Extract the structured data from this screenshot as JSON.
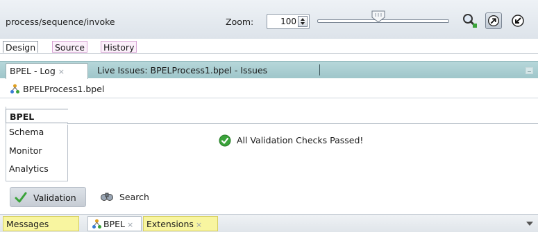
{
  "editor": {
    "path": "process/sequence/invoke",
    "zoom_label": "Zoom:",
    "zoom_value": "100",
    "zoom_slider_level_percent": 46,
    "icons": [
      "zoom-to-fit-icon",
      "pan-icon",
      "collapse-icon"
    ]
  },
  "view_tabs": {
    "design": "Design",
    "source": "Source",
    "history": "History"
  },
  "log_panel": {
    "active_tab": "BPEL - Log",
    "close_glyph": "×",
    "inactive_tab": "Live Issues: BPELProcess1.bpel - Issues"
  },
  "file": {
    "name": "BPELProcess1.bpel",
    "icon": "bpel-process-icon"
  },
  "categories": [
    "BPEL",
    "Schema",
    "Monitor",
    "Analytics"
  ],
  "status_message": "All Validation Checks Passed!",
  "toolbar": {
    "validation": "Validation",
    "search": "Search"
  },
  "bottom_tabs": {
    "messages": "Messages",
    "bpel": "BPEL",
    "extensions": "Extensions",
    "close_glyph": "×"
  },
  "colors": {
    "log_tab_strip": "#a9cfd2",
    "yellow_tab": "#f8f5a0",
    "pink_tab": "#fbeffa",
    "check_green": "#3aa33a"
  }
}
